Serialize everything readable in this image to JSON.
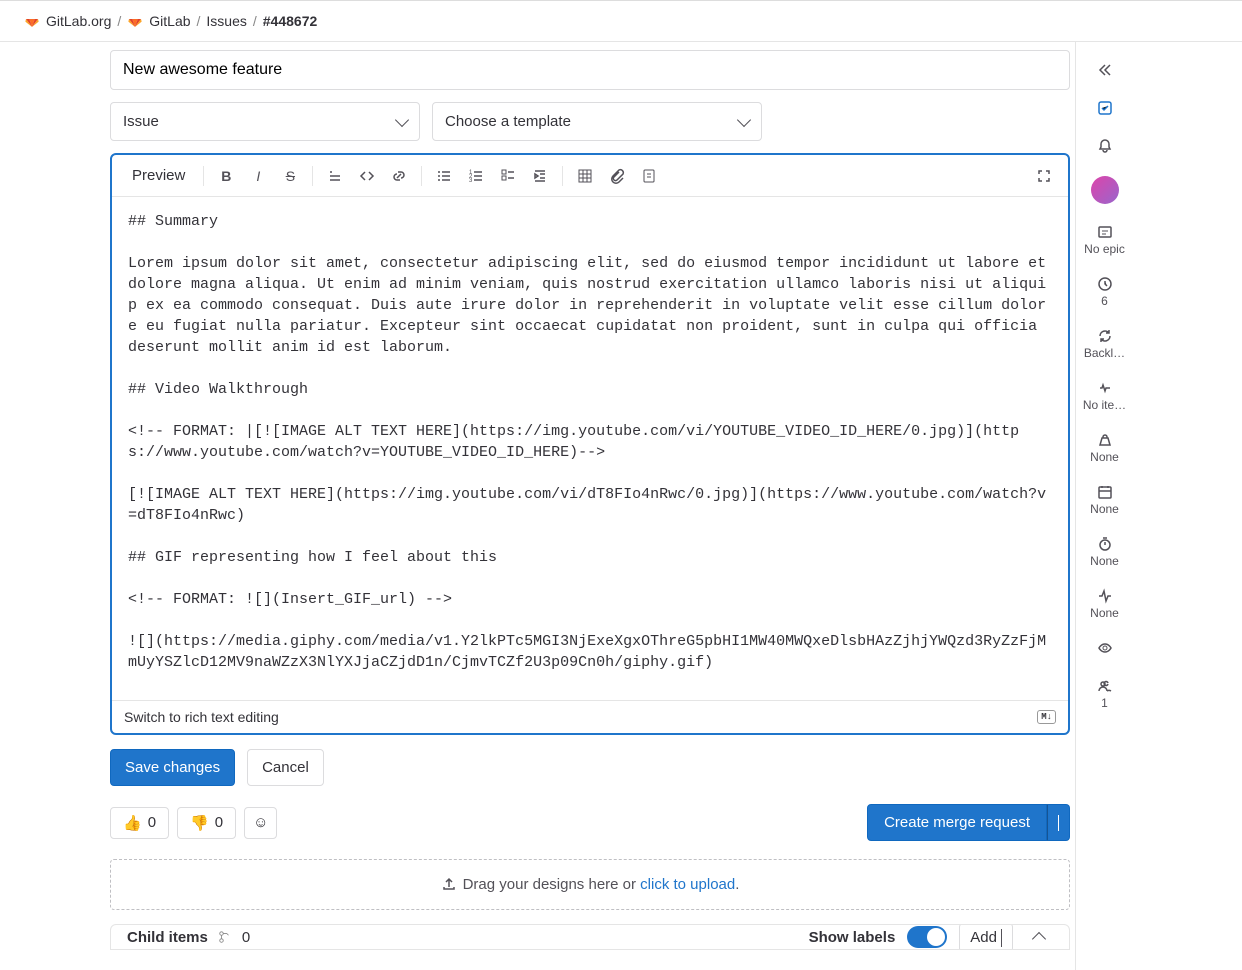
{
  "breadcrumb": {
    "org": "GitLab.org",
    "project": "GitLab",
    "section": "Issues",
    "id": "#448672"
  },
  "issue": {
    "title": "New awesome feature",
    "type_label": "Issue",
    "template_placeholder": "Choose a template"
  },
  "toolbar": {
    "preview": "Preview"
  },
  "editor": {
    "content": "## Summary\n\nLorem ipsum dolor sit amet, consectetur adipiscing elit, sed do eiusmod tempor incididunt ut labore et dolore magna aliqua. Ut enim ad minim veniam, quis nostrud exercitation ullamco laboris nisi ut aliquip ex ea commodo consequat. Duis aute irure dolor in reprehenderit in voluptate velit esse cillum dolore eu fugiat nulla pariatur. Excepteur sint occaecat cupidatat non proident, sunt in culpa qui officia deserunt mollit anim id est laborum.\n\n## Video Walkthrough\n\n<!-- FORMAT: |[![IMAGE ALT TEXT HERE](https://img.youtube.com/vi/YOUTUBE_VIDEO_ID_HERE/0.jpg)](https://www.youtube.com/watch?v=YOUTUBE_VIDEO_ID_HERE)-->\n\n[![IMAGE ALT TEXT HERE](https://img.youtube.com/vi/dT8FIo4nRwc/0.jpg)](https://www.youtube.com/watch?v=dT8FIo4nRwc)\n\n## GIF representing how I feel about this\n\n<!-- FORMAT: ![](Insert_GIF_url) -->\n\n![](https://media.giphy.com/media/v1.Y2lkPTc5MGI3NjExeXgxOThreG5pbHI1MW40MWQxeDlsbHAzZjhjYWQzd3RyZzFjMmUyYSZlcD12MV9naWZzX3NlYXJjaCZjdD1n/CjmvTCZf2U3p09Cn0h/giphy.gif)",
    "switch_label": "Switch to rich text editing",
    "md_badge": "M↓"
  },
  "actions": {
    "save": "Save changes",
    "cancel": "Cancel"
  },
  "reactions": {
    "thumbs_up": {
      "emoji": "👍",
      "count": "0"
    },
    "thumbs_down": {
      "emoji": "👎",
      "count": "0"
    },
    "add_emoji": "☺"
  },
  "merge": {
    "label": "Create merge request"
  },
  "designs": {
    "text_prefix": "Drag your designs here or ",
    "link": "click to upload",
    "text_suffix": "."
  },
  "child": {
    "label": "Child items",
    "count": "0",
    "show_labels": "Show labels",
    "add": "Add"
  },
  "sidebar": {
    "epic": "No epic",
    "milestone_count": "6",
    "iteration": "Backl…",
    "health": "No ite…",
    "weight": "None",
    "due": "None",
    "time": "None",
    "activity": "None",
    "participants": "1"
  }
}
